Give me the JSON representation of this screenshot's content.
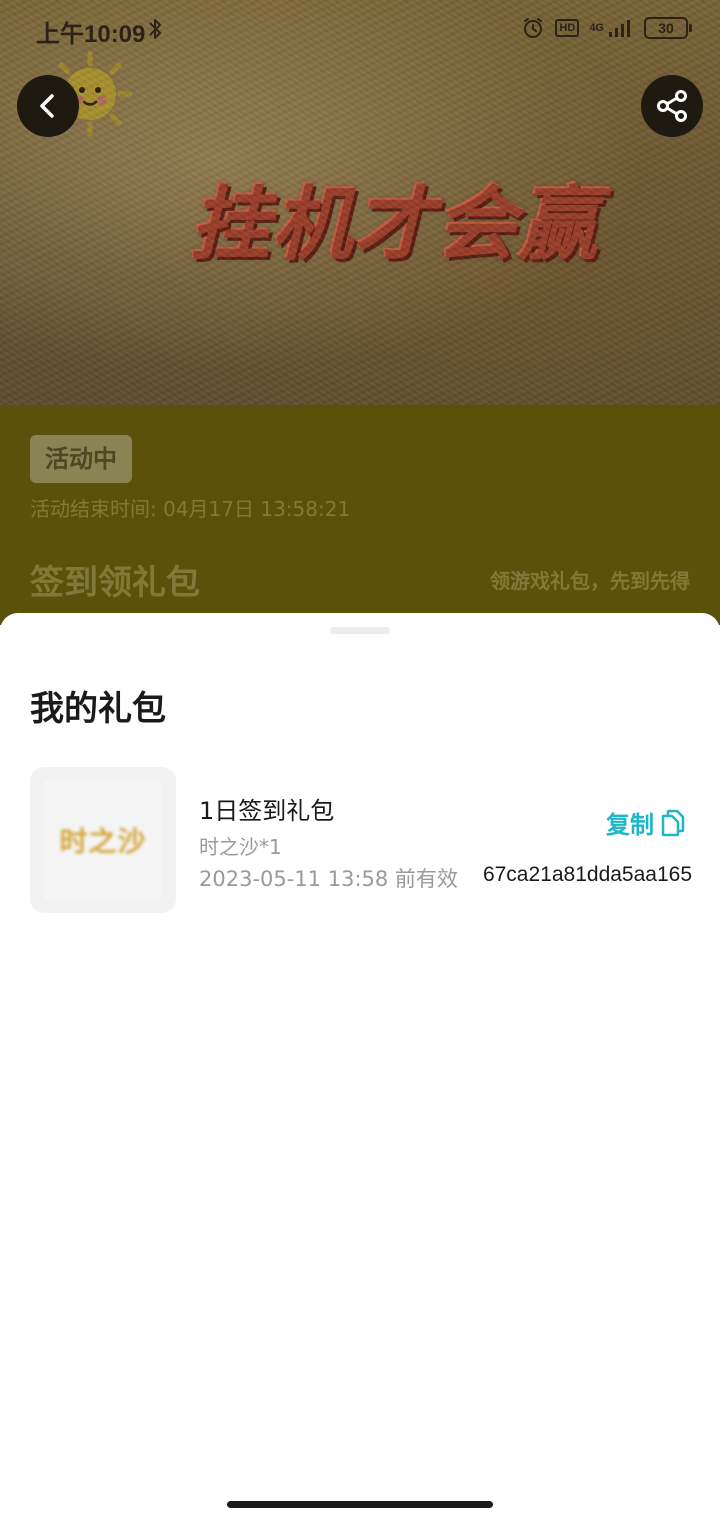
{
  "status_bar": {
    "time": "上午10:09",
    "signal_label": "4G",
    "hd_label": "HD",
    "battery": "30"
  },
  "hero": {
    "slogan": "挂机才会赢",
    "back_icon": "chevron-left-icon",
    "share_icon": "share-icon"
  },
  "activity": {
    "status_badge": "活动中",
    "end_time": "活动结束时间: 04月17日 13:58:21",
    "title": "签到领礼包",
    "subtitle": "领游戏礼包，先到先得"
  },
  "sheet": {
    "title": "我的礼包",
    "gifts": [
      {
        "thumb_text": "时之沙",
        "name": "1日签到礼包",
        "item": "时之沙*1",
        "expire": "2023-05-11 13:58 前有效",
        "copy_label": "复制",
        "code": "67ca21a81dda5aa165"
      }
    ]
  },
  "colors": {
    "accent": "#1fb6c9",
    "info_bg": "#5a520a"
  }
}
